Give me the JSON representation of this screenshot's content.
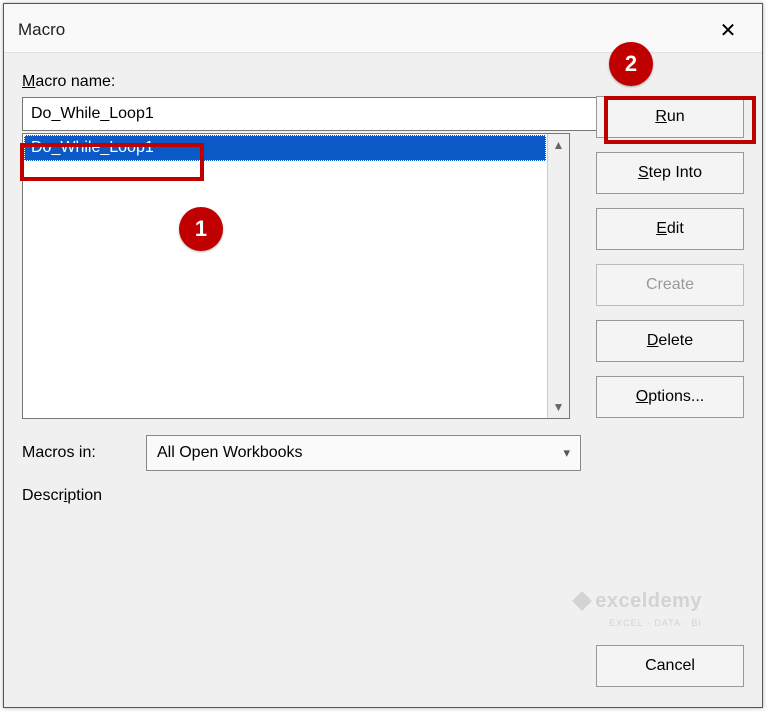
{
  "dialog": {
    "title": "Macro",
    "close_glyph": "✕"
  },
  "macro_name": {
    "label_pre": "M",
    "label_post": "acro name:",
    "value": "Do_While_Loop1"
  },
  "macro_list": {
    "items": [
      "Do_While_Loop1"
    ],
    "selected_index": 0
  },
  "macros_in": {
    "label_pre": "M",
    "label_post": "acros in:",
    "value": "All Open Workbooks"
  },
  "description": {
    "label_pre": "D",
    "label_post": "escription",
    "value": ""
  },
  "buttons": {
    "run_u": "R",
    "run_rest": "un",
    "step_u": "S",
    "step_rest": "tep Into",
    "edit_u": "E",
    "edit_rest": "dit",
    "create": "Create",
    "delete_u": "D",
    "delete_rest": "elete",
    "options_u": "O",
    "options_rest": "ptions...",
    "cancel": "Cancel"
  },
  "annotations": {
    "badge1": "1",
    "badge2": "2"
  },
  "watermark": {
    "brand": "exceldemy",
    "tag": "EXCEL · DATA · BI"
  }
}
